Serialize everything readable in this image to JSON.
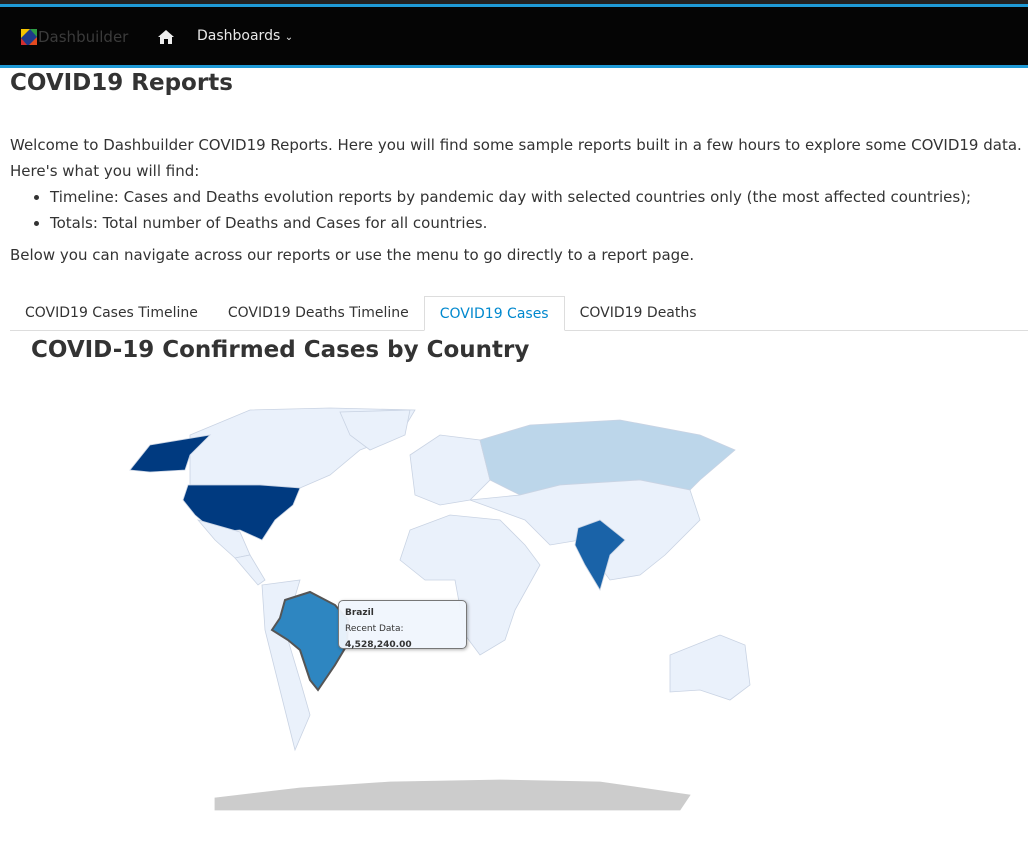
{
  "navbar": {
    "brand": "Dashbuilder",
    "dashboards_label": "Dashboards"
  },
  "page": {
    "title": "COVID19 Reports",
    "intro": "Welcome to Dashbuilder COVID19 Reports. Here you will find some sample reports built in a few hours to explore some COVID19 data. Here's what you will find:",
    "bullets": [
      "Timeline: Cases and Deaths evolution reports by pandemic day with selected countries only (the most affected countries);",
      "Totals: Total number of Deaths and Cases for all countries."
    ],
    "below": "Below you can navigate across our reports or use the menu to go directly to a report page."
  },
  "tabs": [
    {
      "label": "COVID19 Cases Timeline"
    },
    {
      "label": "COVID19 Deaths Timeline"
    },
    {
      "label": "COVID19 Cases",
      "active": true
    },
    {
      "label": "COVID19 Deaths"
    }
  ],
  "map": {
    "title": "COVID-19 Confirmed Cases by Country",
    "colors": {
      "usa": "#003a80",
      "india": "#1a63a8",
      "brazil": "#2e86c1",
      "russia": "#bcd6ea",
      "default": "#eaf1fb",
      "nodata": "#cccccc"
    },
    "tooltip": {
      "country": "Brazil",
      "label": "Recent Data:",
      "value": "4,528,240.00"
    }
  }
}
